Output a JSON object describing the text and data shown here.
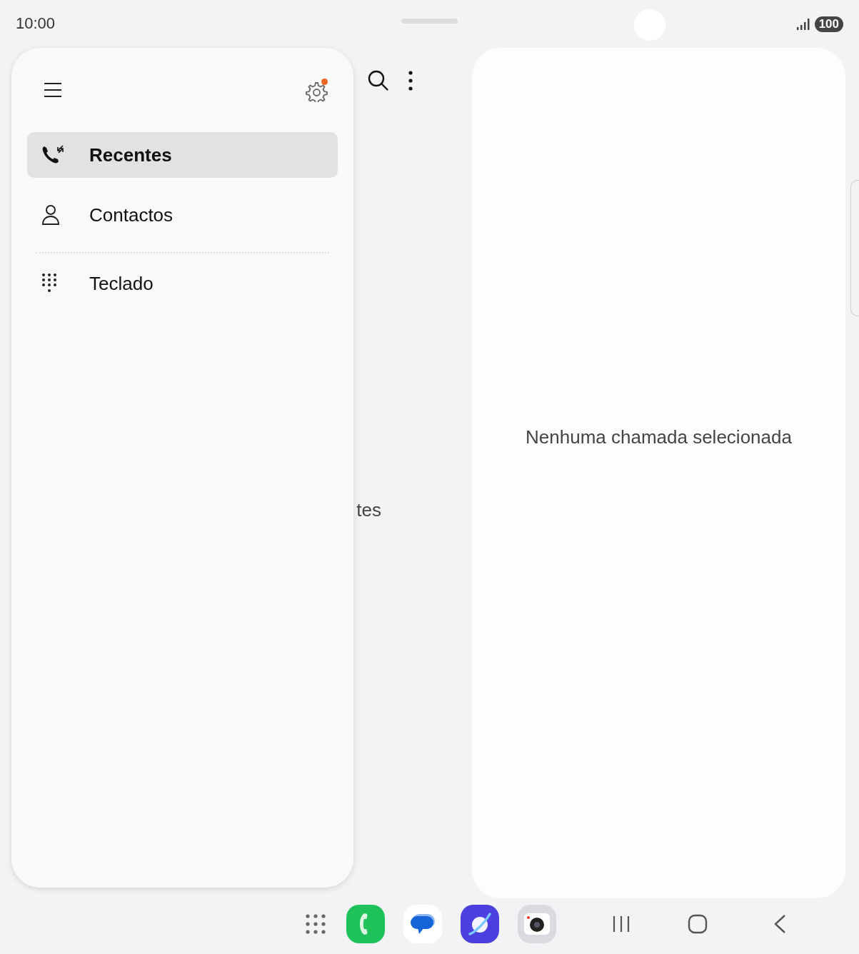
{
  "status_bar": {
    "time": "10:00",
    "battery": "100"
  },
  "drawer": {
    "settings_badge": true,
    "items": [
      {
        "kind": "recents",
        "label": "Recentes",
        "selected": true,
        "divider_before": false
      },
      {
        "kind": "contacts",
        "label": "Contactos",
        "selected": false,
        "divider_before": false
      },
      {
        "kind": "keypad",
        "label": "Teclado",
        "selected": false,
        "divider_before": true
      }
    ]
  },
  "list_pane": {
    "empty_text": "tes"
  },
  "detail_pane": {
    "empty_text": "Nenhuma chamada selecionada"
  }
}
